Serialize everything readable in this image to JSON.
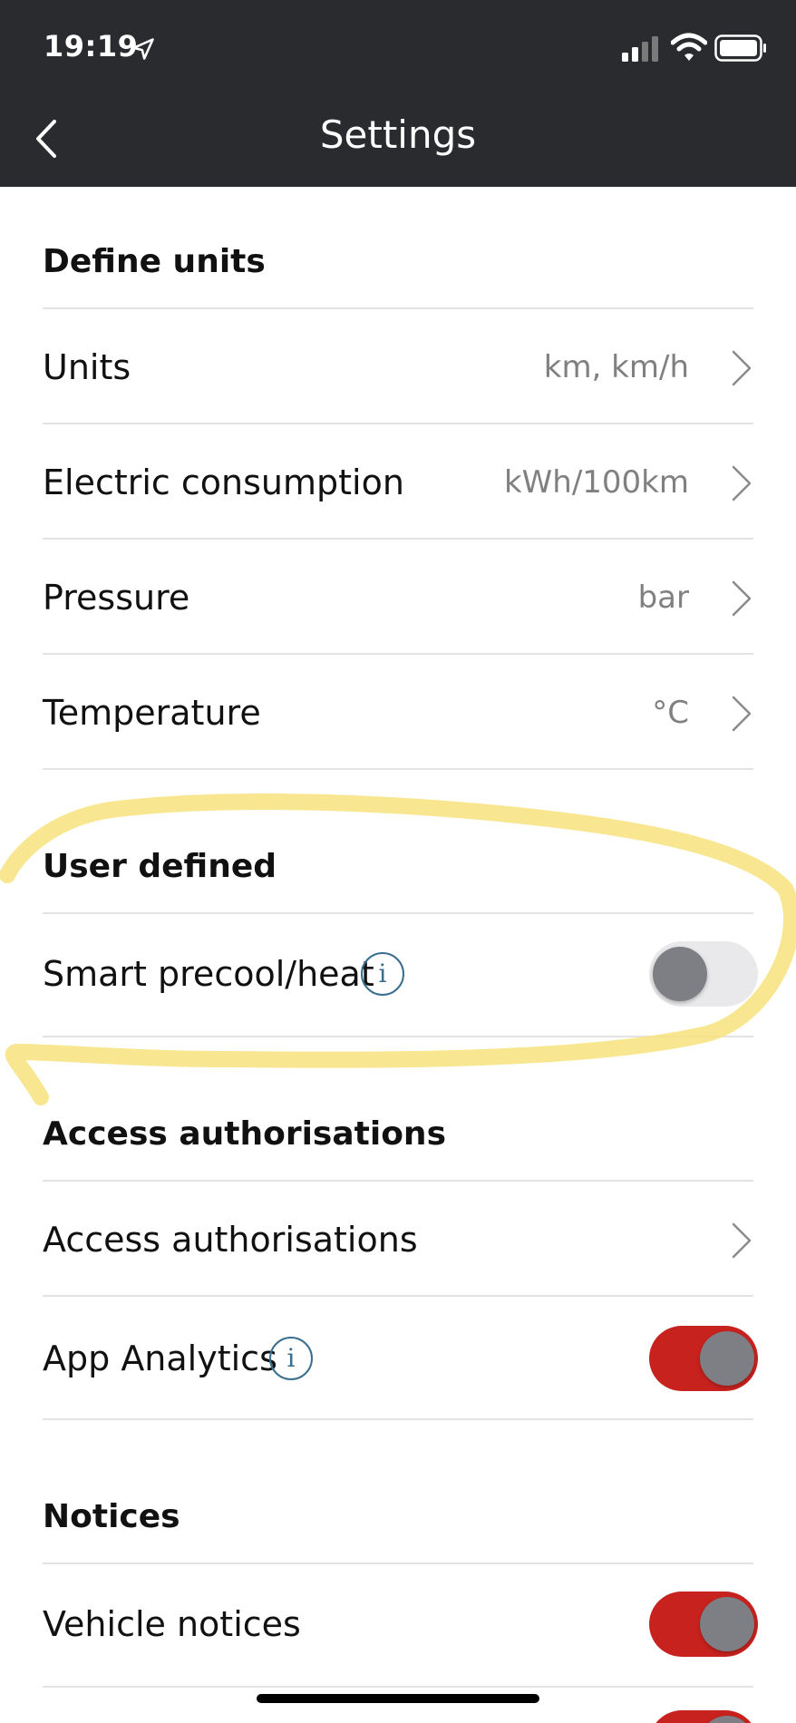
{
  "status_bar": {
    "time": "19:19",
    "icons": [
      "location-arrow-icon",
      "cellular-signal-icon",
      "wifi-icon",
      "battery-icon"
    ]
  },
  "header": {
    "title": "Settings",
    "back_icon": "chevron-left-icon"
  },
  "sections": {
    "define_units": {
      "title": "Define units",
      "rows": [
        {
          "label": "Units",
          "value": "km, km/h"
        },
        {
          "label": "Electric consumption",
          "value": "kWh/100km"
        },
        {
          "label": "Pressure",
          "value": "bar"
        },
        {
          "label": "Temperature",
          "value": "°C"
        }
      ]
    },
    "user_defined": {
      "title": "User defined",
      "rows": [
        {
          "label": "Smart precool/heat",
          "info_icon": "i",
          "toggle": "off"
        }
      ]
    },
    "access": {
      "title": "Access authorisations",
      "rows": [
        {
          "label": "Access authorisations"
        },
        {
          "label": "App Analytics",
          "info_icon": "i",
          "toggle": "on"
        }
      ]
    },
    "notices": {
      "title": "Notices",
      "rows": [
        {
          "label": "Vehicle notices",
          "toggle": "on"
        }
      ]
    }
  },
  "colors": {
    "header_bg": "#2a2b2e",
    "toggle_on": "#c8221e",
    "toggle_off": "#e9e9eb",
    "highlight": "#f7e27c",
    "info_icon": "#3a6e8f"
  }
}
